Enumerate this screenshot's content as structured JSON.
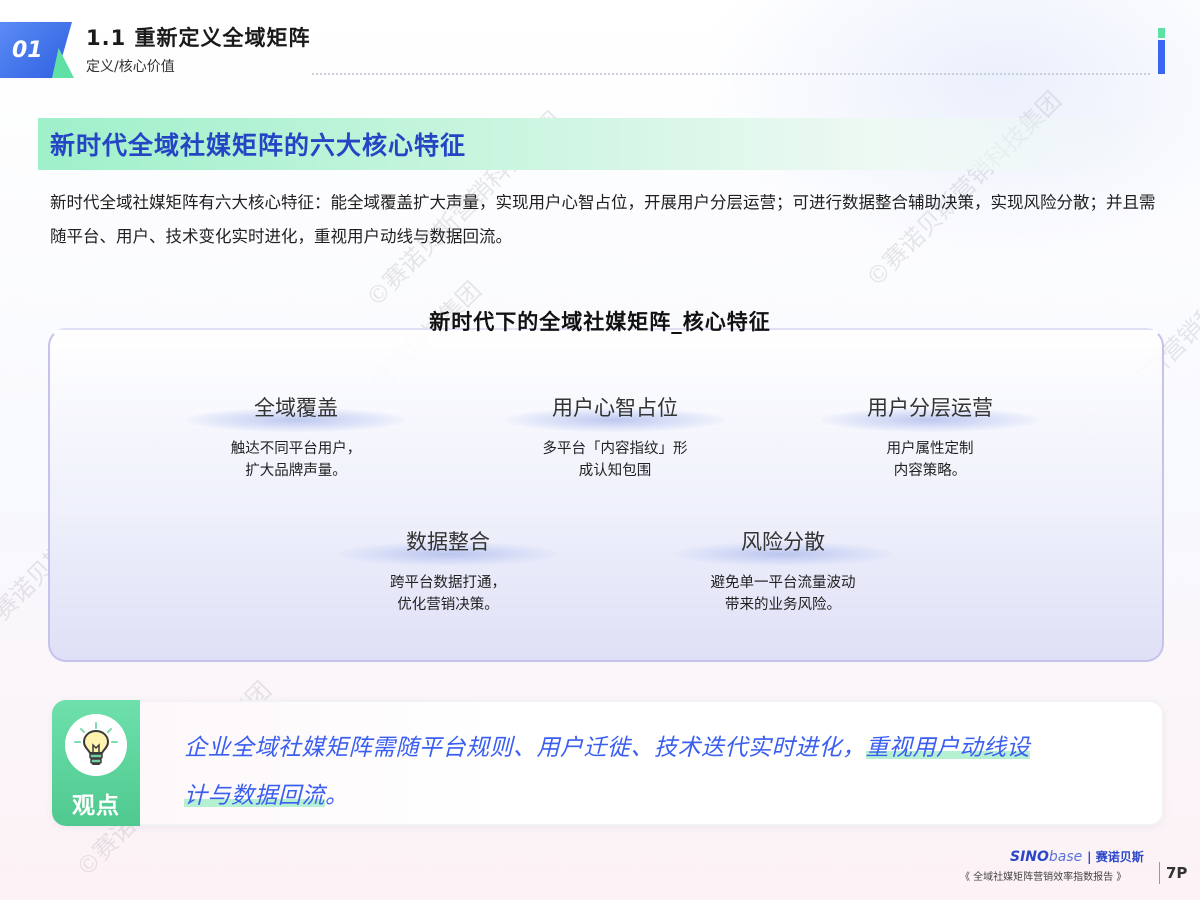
{
  "header": {
    "section_number": "01",
    "title": "1.1 重新定义全域矩阵",
    "subtitle": "定义/核心价值"
  },
  "banner": {
    "title": "新时代全域社媒矩阵的六大核心特征"
  },
  "intro": "新时代全域社媒矩阵有六大核心特征：能全域覆盖扩大声量，实现用户心智占位，开展用户分层运营；可进行数据整合辅助决策，实现风险分散；并且需随平台、用户、技术变化实时进化，重视用户动线与数据回流。",
  "diagram": {
    "title": "新时代下的全域社媒矩阵_核心特征",
    "features": [
      {
        "name": "全域覆盖",
        "desc_line1": "触达不同平台用户，",
        "desc_line2": "扩大品牌声量。"
      },
      {
        "name": "用户心智占位",
        "desc_line1": "多平台「内容指纹」形",
        "desc_line2": "成认知包围"
      },
      {
        "name": "用户分层运营",
        "desc_line1": "用户属性定制",
        "desc_line2": "内容策略。"
      },
      {
        "name": "数据整合",
        "desc_line1": "跨平台数据打通，",
        "desc_line2": "优化营销决策。"
      },
      {
        "name": "风险分散",
        "desc_line1": "避免单一平台流量波动",
        "desc_line2": "带来的业务风险。"
      }
    ]
  },
  "viewpoint": {
    "label": "观点",
    "icon": "lightbulb-icon",
    "text_plain": "企业全域社媒矩阵需随平台规则、用户迁徙、技术迭代实时进化，",
    "text_emphasis_1": "重视用户动线设",
    "text_emphasis_2": "计与数据回流",
    "text_end": "。"
  },
  "watermark": "©赛诺贝斯营销科技集团",
  "footer": {
    "brand_bold": "SINO",
    "brand_light": "base",
    "brand_cn": "| 赛诺贝斯",
    "report_name": "《 全域社媒矩阵营销效率指数报告 》",
    "page": "7P"
  },
  "colors": {
    "accent_blue": "#3b67f0",
    "accent_green": "#5fe0a4",
    "title_blue": "#2446c4",
    "view_text_blue": "#3a5ff0"
  }
}
